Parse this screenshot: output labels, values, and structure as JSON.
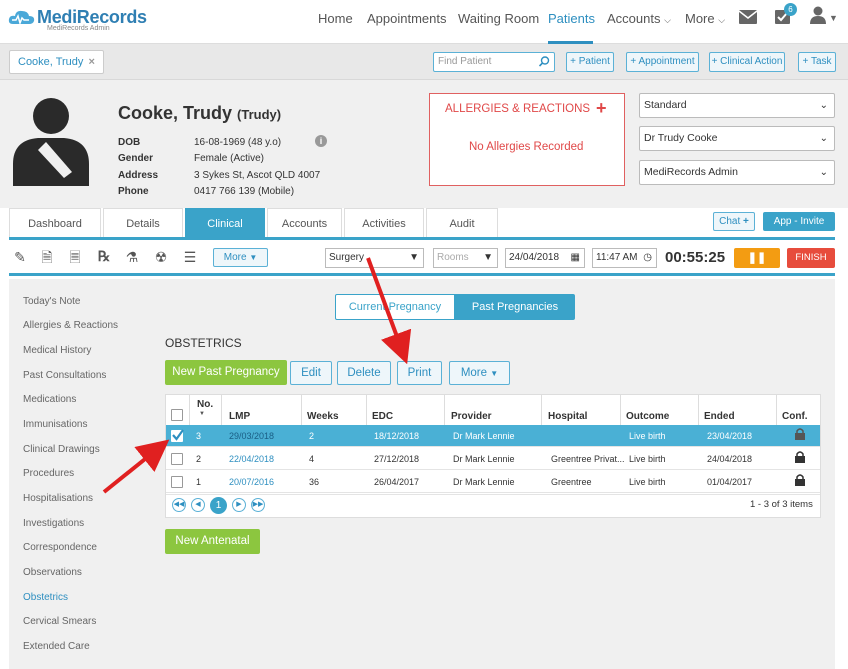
{
  "app": {
    "brand": "MediRecords",
    "brand_sub": "MediRecords Admin"
  },
  "nav": {
    "items": [
      "Home",
      "Appointments",
      "Waiting Room",
      "Patients",
      "Accounts",
      "More"
    ],
    "tasks_badge": "6"
  },
  "patient_tab": {
    "label": "Cooke, Trudy",
    "close": "×"
  },
  "toolbar_top": {
    "find_placeholder": "Find Patient",
    "buttons": [
      "+ Patient",
      "+ Appointment",
      "+ Clinical Action",
      "+ Task"
    ]
  },
  "patient": {
    "name": "Cooke, Trudy",
    "preferred": "(Trudy)",
    "fields": [
      {
        "label": "DOB",
        "value": "16-08-1969 (48 y.o)"
      },
      {
        "label": "Gender",
        "value": "Female (Active)"
      },
      {
        "label": "Address",
        "value": "3 Sykes St, Ascot QLD 4007"
      },
      {
        "label": "Phone",
        "value": "0417 766 139 (Mobile)"
      }
    ]
  },
  "allergies": {
    "title": "ALLERGIES & REACTIONS",
    "add": "+",
    "none": "No Allergies Recorded"
  },
  "selects": [
    "Standard",
    "Dr Trudy Cooke",
    "MediRecords Admin"
  ],
  "module_tabs": [
    "Dashboard",
    "Details",
    "Clinical",
    "Accounts",
    "Activities",
    "Audit"
  ],
  "chat_label": "Chat",
  "app_invite_label": "App - Invite",
  "clinical_toolbar": {
    "more": "More",
    "location": "Surgery",
    "rooms": "Rooms",
    "date": "24/04/2018",
    "time": "11:47 AM",
    "timer": "00:55:25",
    "finish": "FINISH"
  },
  "sidebar": [
    "Today's Note",
    "Allergies & Reactions",
    "Medical History",
    "Past Consultations",
    "Medications",
    "Immunisations",
    "Clinical Drawings",
    "Procedures",
    "Hospitalisations",
    "Investigations",
    "Correspondence",
    "Observations",
    "Obstetrics",
    "Cervical Smears",
    "Extended Care"
  ],
  "segments": [
    "Current Pregnancy",
    "Past Pregnancies"
  ],
  "section_title": "OBSTETRICS",
  "actions": {
    "new_past": "New Past Pregnancy",
    "edit": "Edit",
    "delete": "Delete",
    "print": "Print",
    "more": "More"
  },
  "table": {
    "headers": [
      "No.",
      "LMP",
      "Weeks",
      "EDC",
      "Provider",
      "Hospital",
      "Outcome",
      "Ended",
      "Conf."
    ],
    "rows": [
      {
        "no": "3",
        "lmp": "29/03/2018",
        "weeks": "2",
        "edc": "18/12/2018",
        "provider": "Dr Mark Lennie",
        "hospital": "",
        "outcome": "Live birth",
        "ended": "23/04/2018",
        "checked": true
      },
      {
        "no": "2",
        "lmp": "22/04/2018",
        "weeks": "4",
        "edc": "27/12/2018",
        "provider": "Dr Mark Lennie",
        "hospital": "Greentree Privat...",
        "outcome": "Live birth",
        "ended": "24/04/2018",
        "checked": false
      },
      {
        "no": "1",
        "lmp": "20/07/2016",
        "weeks": "36",
        "edc": "26/04/2017",
        "provider": "Dr Mark Lennie",
        "hospital": "Greentree",
        "outcome": "Live birth",
        "ended": "01/04/2017",
        "checked": false
      }
    ],
    "page": "1",
    "count": "1 - 3 of 3 items"
  },
  "new_antenatal": "New Antenatal",
  "colors": {
    "accent": "#3aa3c9",
    "green": "#8cc63f",
    "red": "#e74c3c",
    "orange": "#f39c12",
    "arrow": "#e02020"
  }
}
